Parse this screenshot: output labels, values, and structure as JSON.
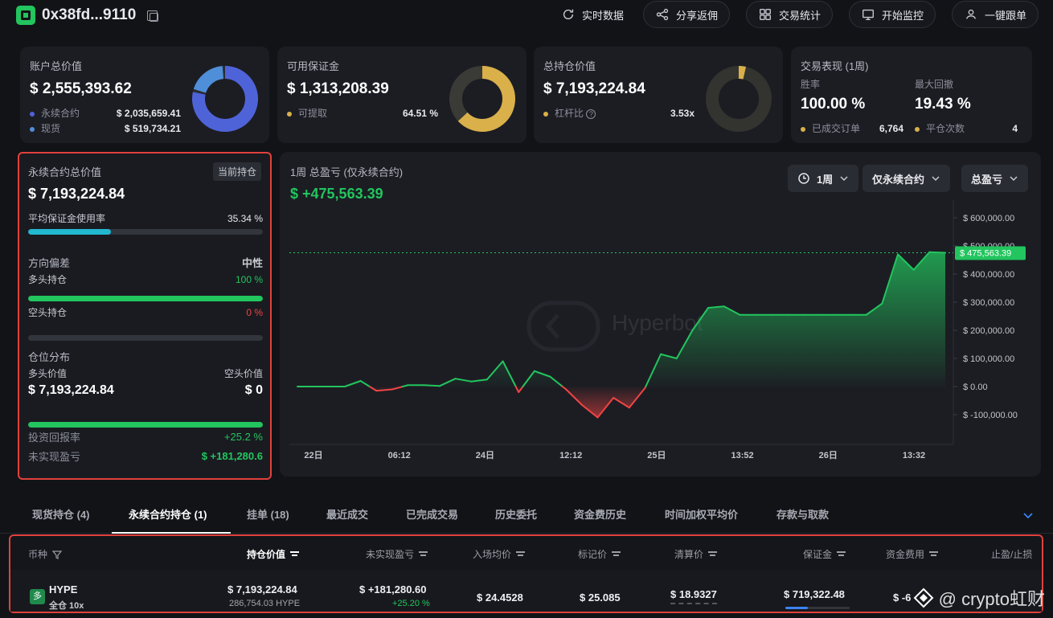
{
  "header": {
    "address": "0x38fd...9110",
    "buttons": {
      "realtime": "实时数据",
      "share": "分享返佣",
      "stats": "交易统计",
      "monitor": "开始监控",
      "copy_trade": "一键跟单"
    }
  },
  "summary": {
    "total_value": {
      "title": "账户总价值",
      "value": "$ 2,555,393.62",
      "perp_label": "永续合约",
      "perp_value": "$ 2,035,659.41",
      "spot_label": "现货",
      "spot_value": "$ 519,734.21",
      "donut": {
        "perp": 0.797,
        "spot": 0.203
      }
    },
    "margin": {
      "title": "可用保证金",
      "value": "$ 1,313,208.39",
      "withdraw_label": "可提取",
      "withdraw_value": "64.51 %",
      "donut": {
        "fill": 0.6451
      }
    },
    "positions": {
      "title": "总持仓价值",
      "value": "$ 7,193,224.84",
      "leverage_label": "杠杆比",
      "leverage_value": "3.53x",
      "donut": {
        "fill": 0.05
      }
    },
    "performance": {
      "title": "交易表现 (1周)",
      "win_label": "胜率",
      "win_value": "100.00 %",
      "drawdown_label": "最大回撤",
      "drawdown_value": "19.43 %",
      "orders_label": "已成交订单",
      "orders_value": "6,764",
      "close_label": "平仓次数",
      "close_value": "4"
    }
  },
  "perp_panel": {
    "title": "永续合约总价值",
    "badge": "当前持仓",
    "value": "$ 7,193,224.84",
    "margin_usage_label": "平均保证金使用率",
    "margin_usage_value": "35.34 %",
    "margin_usage": 0.3534,
    "bias_label": "方向偏差",
    "bias_value": "中性",
    "long_label": "多头持仓",
    "long_value": "100 %",
    "long": 1.0,
    "short_label": "空头持仓",
    "short_value": "0 %",
    "short": 0.0,
    "dist_label": "仓位分布",
    "long_val_label": "多头价值",
    "short_val_label": "空头价值",
    "long_val": "$ 7,193,224.84",
    "short_val": "$ 0",
    "dist_long": 1.0,
    "roi_label": "投资回报率",
    "roi_value": "+25.2 %",
    "upnl_label": "未实现盈亏",
    "upnl_value": "$ +181,280.6"
  },
  "pnl_chart": {
    "title": "1周 总盈亏 (仅永续合约)",
    "value": "$ +475,563.39",
    "period": "1周",
    "filter": "仅永续合约",
    "metric": "总盈亏",
    "watermark": "Hyperbot",
    "current_label": "$ 475,563.39"
  },
  "chart_data": {
    "type": "area",
    "title": "1周 总盈亏 (仅永续合约)",
    "x_tick_labels": [
      "22日",
      "06:12",
      "24日",
      "12:12",
      "25日",
      "13:52",
      "26日",
      "13:32"
    ],
    "y_tick_labels": [
      "$ 600,000.00",
      "$ 500,000.00",
      "$ 400,000.00",
      "$ 300,000.00",
      "$ 200,000.00",
      "$ 100,000.00",
      "$ 0.00",
      "$ -100,000.00"
    ],
    "ylim": [
      -100000,
      600000
    ],
    "y_ticks": [
      600000,
      500000,
      400000,
      300000,
      200000,
      100000,
      0,
      -100000
    ],
    "series": [
      {
        "values": [
          0,
          0,
          0,
          0,
          20000,
          -15000,
          -10000,
          5000,
          5000,
          2000,
          28000,
          18000,
          25000,
          90000,
          -20000,
          55000,
          35000,
          -10000,
          -65000,
          -110000,
          -40000,
          -75000,
          -5000,
          115000,
          100000,
          200000,
          280000,
          285000,
          255000,
          255000,
          255000,
          255000,
          255000,
          255000,
          255000,
          255000,
          255000,
          295000,
          470000,
          415000,
          478000,
          475563
        ]
      }
    ],
    "reference_value": 475563.39,
    "grid": false
  },
  "tabs": [
    {
      "label": "现货持仓 (4)"
    },
    {
      "label": "永续合约持仓 (1)"
    },
    {
      "label": "挂单 (18)"
    },
    {
      "label": "最近成交"
    },
    {
      "label": "已完成交易"
    },
    {
      "label": "历史委托"
    },
    {
      "label": "资金费历史"
    },
    {
      "label": "时间加权平均价"
    },
    {
      "label": "存款与取款"
    }
  ],
  "table": {
    "columns": [
      "币种",
      "持仓价值",
      "未实现盈亏",
      "入场均价",
      "标记价",
      "清算价",
      "保证金",
      "资金费用",
      "止盈/止损"
    ],
    "row": {
      "side_badge": "多",
      "coin": "HYPE",
      "mode": "全仓 10x",
      "value": "$ 7,193,224.84",
      "size": "286,754.03 HYPE",
      "upnl": "$ +181,280.60",
      "upnl_pct": "+25.20 %",
      "entry": "$ 24.4528",
      "mark": "$ 25.085",
      "liq": "$ 18.9327",
      "margin": "$ 719,322.48",
      "funding": "$ -6"
    }
  },
  "watermark_credit": "@ crypto虹财",
  "colors": {
    "green": "#22c55e",
    "red": "#ef4444",
    "blue": "#4f63d9",
    "gold": "#d9b04a",
    "cyan": "#22b8cf"
  }
}
